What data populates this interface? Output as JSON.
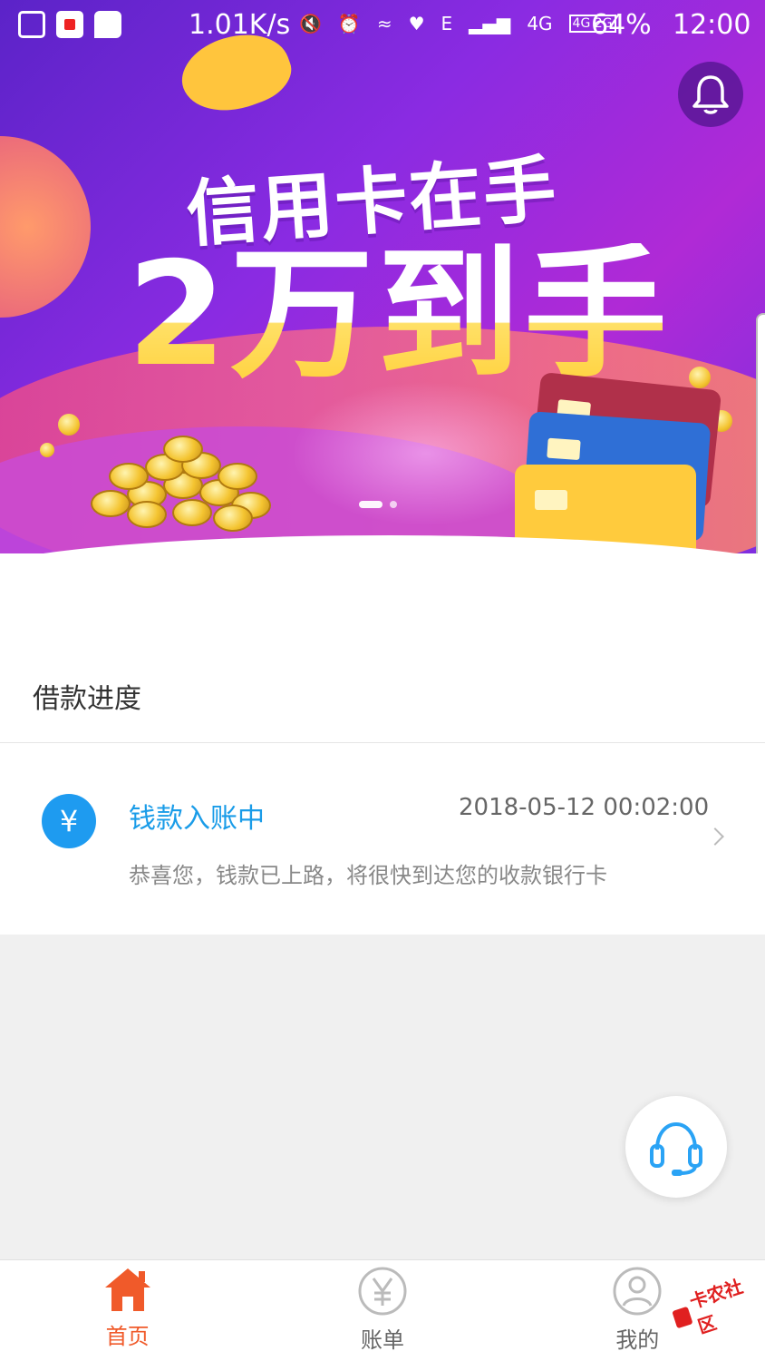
{
  "status_bar": {
    "speed": "1.01K/s",
    "network_e": "E",
    "network_4g": "4G",
    "dual_sim": "4G 2G",
    "battery": "64%",
    "time": "12:00"
  },
  "banner": {
    "headline_line1": "信用卡在手",
    "headline_line2": "2万到手",
    "slide_count": 2,
    "active_slide": 1
  },
  "loan_progress": {
    "section_title": "借款进度",
    "item": {
      "icon_glyph": "¥",
      "status": "钱款入账中",
      "time": "2018-05-12 00:02:00",
      "description": "恭喜您，钱款已上路，将很快到达您的收款银行卡"
    }
  },
  "bottom_nav": {
    "items": [
      {
        "label": "首页",
        "icon": "home-icon",
        "active": true
      },
      {
        "label": "账单",
        "icon": "yen-icon",
        "active": false
      },
      {
        "label": "我的",
        "icon": "user-icon",
        "active": false
      }
    ]
  },
  "watermark": {
    "text": "卡农社区"
  },
  "colors": {
    "accent_orange": "#f05a2a",
    "status_blue": "#1a9ce8",
    "yen_blue": "#1e9bf0",
    "support_blue": "#2aa3f5"
  }
}
